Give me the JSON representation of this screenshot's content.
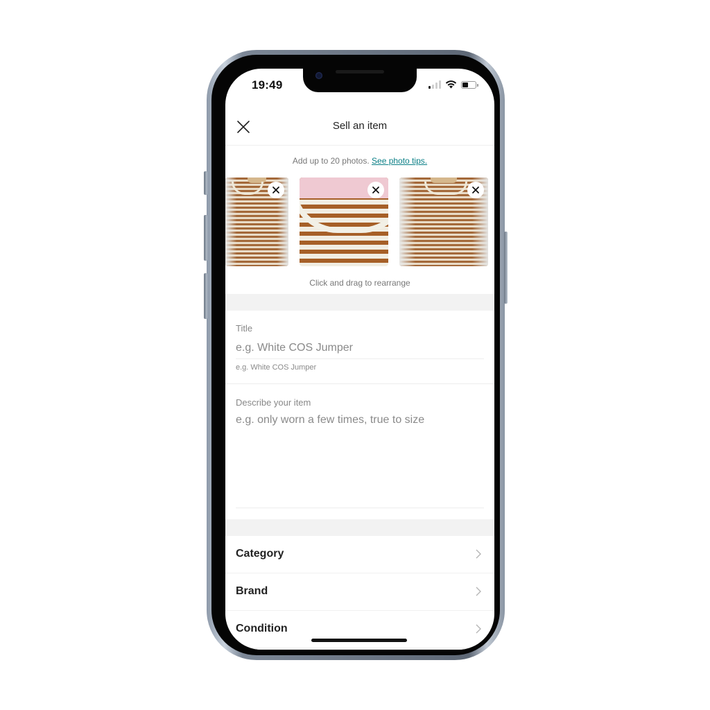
{
  "status_bar": {
    "time": "19:49",
    "signal_bars_active": 1,
    "signal_bars_total": 4,
    "battery_level": 0.45
  },
  "header": {
    "title": "Sell an item",
    "close_icon": "close-icon"
  },
  "photos": {
    "hint_text": "Add up to 20 photos.",
    "tips_link": "See photo tips.",
    "items": [
      {
        "description": "Striped brown t-shirt on hanger (cropped)",
        "remove_icon": "close-icon"
      },
      {
        "description": "Close-up of striped t-shirt collar with label",
        "remove_icon": "close-icon"
      },
      {
        "description": "Striped brown t-shirt on hanger",
        "remove_icon": "close-icon"
      }
    ],
    "rearrange_hint": "Click and drag to rearrange"
  },
  "form": {
    "title": {
      "label": "Title",
      "value": "",
      "placeholder": "e.g. White COS Jumper",
      "helper": "e.g. White COS Jumper"
    },
    "description": {
      "label": "Describe your item",
      "value": "",
      "placeholder": "e.g. only worn a few times, true to size"
    }
  },
  "attributes": [
    {
      "label": "Category",
      "icon": "chevron-right-icon"
    },
    {
      "label": "Brand",
      "icon": "chevron-right-icon"
    },
    {
      "label": "Condition",
      "icon": "chevron-right-icon"
    }
  ],
  "colors": {
    "link": "#0a7f86",
    "separator": "#f2f2f2",
    "text_primary": "#222222",
    "text_secondary": "#888888"
  }
}
